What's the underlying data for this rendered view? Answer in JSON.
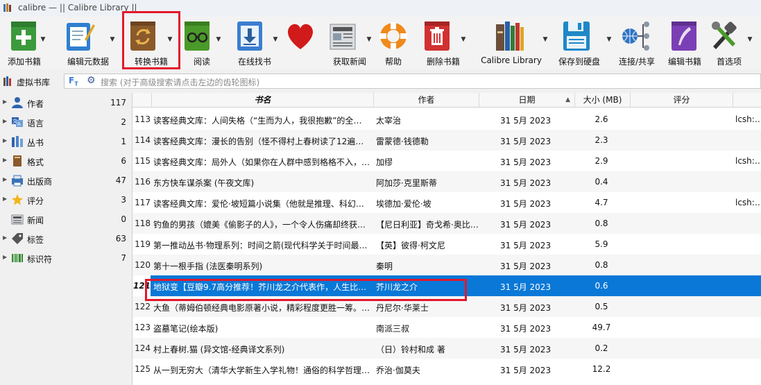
{
  "window": {
    "title": "calibre — || Calibre Library ||"
  },
  "toolbar": {
    "add_books": "添加书籍",
    "edit_metadata": "编辑元数据",
    "convert_books": "转换书籍",
    "view": "阅读",
    "get_books": "在线找书",
    "fetch_news": "获取新闻",
    "help": "帮助",
    "remove_books": "删除书籍",
    "library": "Calibre Library",
    "save_to_disk": "保存到硬盘",
    "connect_share": "连接/共享",
    "edit_book": "编辑书籍",
    "preferences": "首选项"
  },
  "search": {
    "virtual_library": "虚拟书库",
    "placeholder": "搜索 (对于高级搜索请点击左边的齿轮图标)"
  },
  "tag_browser": [
    {
      "name": "作者",
      "count": "117",
      "icon": "person-icon"
    },
    {
      "name": "语言",
      "count": "2",
      "icon": "language-icon"
    },
    {
      "name": "丛书",
      "count": "1",
      "icon": "series-icon"
    },
    {
      "name": "格式",
      "count": "6",
      "icon": "format-icon"
    },
    {
      "name": "出版商",
      "count": "47",
      "icon": "publisher-icon"
    },
    {
      "name": "评分",
      "count": "3",
      "icon": "star-icon"
    },
    {
      "name": "新闻",
      "count": "0",
      "icon": "news-icon"
    },
    {
      "name": "标签",
      "count": "63",
      "icon": "tag-icon"
    },
    {
      "name": "标识符",
      "count": "7",
      "icon": "barcode-icon"
    }
  ],
  "columns": {
    "title": "书名",
    "author": "作者",
    "date": "日期",
    "size": "大小 (MB)",
    "rating": "评分"
  },
  "books": [
    {
      "num": "113",
      "title": "读客经典文库：人间失格（“生而为人，我很抱歉”的全面…",
      "author": "太宰治",
      "date": "31 5月 2023",
      "size": "2.6",
      "tags": "lcsh: N"
    },
    {
      "num": "114",
      "title": "读客经典文库：漫长的告别（怪不得村上春树读了12遍！…",
      "author": "雷蒙德·钱德勒",
      "date": "31 5月 2023",
      "size": "2.3",
      "tags": ""
    },
    {
      "num": "115",
      "title": "读客经典文库：局外人（如果你在人群中感到格格不入，…",
      "author": "加缪",
      "date": "31 5月 2023",
      "size": "2.9",
      "tags": "lcsh: N"
    },
    {
      "num": "116",
      "title": "东方快车谋杀案 (午夜文库)",
      "author": "阿加莎·克里斯蒂",
      "date": "31 5月 2023",
      "size": "0.4",
      "tags": ""
    },
    {
      "num": "117",
      "title": "读客经典文库：爱伦·坡短篇小说集（他就是推理、科幻、…",
      "author": "埃德加·爱伦·坡",
      "date": "31 5月 2023",
      "size": "4.7",
      "tags": "lcsh: N"
    },
    {
      "num": "118",
      "title": "钓鱼的男孩（媲美《偷影子的人》，一个令人伤痛却终获…",
      "author": "【尼日利亚】奇戈希·奥比…",
      "date": "31 5月 2023",
      "size": "0.8",
      "tags": ""
    },
    {
      "num": "119",
      "title": "第一推动丛书·物理系列：时间之箭(现代科学关于时间最…",
      "author": "【英】彼得·柯文尼",
      "date": "31 5月 2023",
      "size": "5.9",
      "tags": ""
    },
    {
      "num": "120",
      "title": "第十一根手指 (法医秦明系列)",
      "author": "秦明",
      "date": "31 5月 2023",
      "size": "0.8",
      "tags": ""
    },
    {
      "num": "121",
      "title": "地狱变【豆瓣9.7高分推荐！芥川龙之介代表作，人生比…",
      "author": "芥川龙之介",
      "date": "31 5月 2023",
      "size": "0.6",
      "tags": "",
      "selected": true
    },
    {
      "num": "122",
      "title": "大鱼（蒂姆伯顿经典电影原著小说，精彩程度更胜一筹。…",
      "author": "丹尼尔·华莱士",
      "date": "31 5月 2023",
      "size": "0.5",
      "tags": ""
    },
    {
      "num": "123",
      "title": "盗墓笔记(绘本版)",
      "author": "南派三叔",
      "date": "31 5月 2023",
      "size": "49.7",
      "tags": ""
    },
    {
      "num": "124",
      "title": "村上春树.猫 (异文馆-经典译文系列)",
      "author": "（日）铃村和成 著",
      "date": "31 5月 2023",
      "size": "0.2",
      "tags": ""
    },
    {
      "num": "125",
      "title": "从一到无穷大（清华大学新生入学礼物！通俗的科学哲理…",
      "author": "乔治·伽莫夫",
      "date": "31 5月 2023",
      "size": "12.2",
      "tags": ""
    }
  ]
}
